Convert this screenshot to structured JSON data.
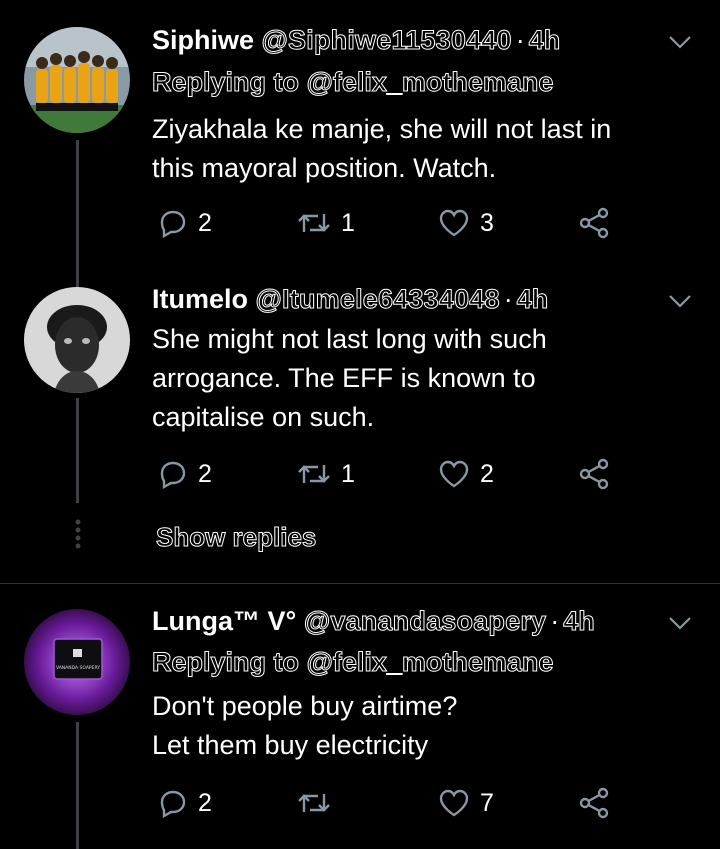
{
  "tweets": [
    {
      "name": "Siphiwe",
      "handle": "@Siphiwe11530440",
      "time": "4h",
      "reply_to": "Replying to @felix_mothemane",
      "lines": [
        "Ziyakhala ke manje, she will not last in",
        "this mayoral position. Watch."
      ],
      "replies": "2",
      "retweets": "1",
      "likes": "3"
    },
    {
      "name": "Itumelo",
      "handle": "@Itumele64334048",
      "time": "4h",
      "lines": [
        "She might not last long with such",
        "arrogance. The EFF is known to",
        "capitalise on such."
      ],
      "replies": "2",
      "retweets": "1",
      "likes": "2",
      "show_replies": "Show replies"
    },
    {
      "name": "Lunga™ V°",
      "handle": "@vanandasoapery",
      "time": "4h",
      "reply_to": "Replying to @felix_mothemane",
      "lines": [
        "Don't people buy airtime?",
        "Let them buy electricity"
      ],
      "replies": "2",
      "retweets": "",
      "likes": "7",
      "avatar_text": "VANANDA SOAPERY"
    }
  ],
  "separator": "·",
  "colors": {
    "background": "#000000",
    "text": "#ffffff",
    "icon": "#8899a6",
    "line": "#3d4247"
  }
}
